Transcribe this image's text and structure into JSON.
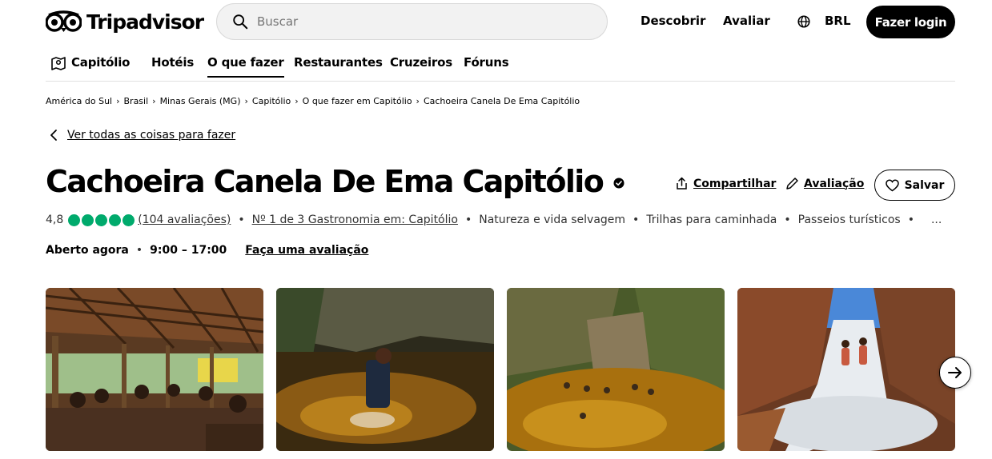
{
  "header": {
    "logo_text": "Tripadvisor",
    "search_placeholder": "Buscar",
    "nav_discover": "Descobrir",
    "nav_review": "Avaliar",
    "currency": "BRL",
    "login_label": "Fazer login"
  },
  "subnav": {
    "city": "Capitólio",
    "items": [
      "Hotéis",
      "O que fazer",
      "Restaurantes",
      "Cruzeiros",
      "Fóruns"
    ],
    "active": "O que fazer"
  },
  "breadcrumb": [
    "América do Sul",
    "Brasil",
    "Minas Gerais (MG)",
    "Capitólio",
    "O que fazer em Capitólio",
    "Cachoeira Canela De Ema Capitólio"
  ],
  "back_link": "Ver todas as coisas para fazer",
  "title": "Cachoeira Canela De Ema Capitólio",
  "actions": {
    "share": "Compartilhar",
    "review": "Avaliação",
    "save": "Salvar"
  },
  "rating": {
    "value": "4,8",
    "bubbles": 5,
    "reviews": "(104 avaliações)",
    "rank": "Nº 1 de 3 Gastronomia em: Capitólio",
    "categories": [
      "Natureza e vida selvagem",
      "Trilhas para caminhada",
      "Passeios turísticos"
    ],
    "more": "..."
  },
  "hours": {
    "status": "Aberto agora",
    "time": "9:00 – 17:00",
    "write_review": "Faça uma avaliação"
  },
  "colors": {
    "brand": "#000000",
    "bubble": "#00aa6c"
  }
}
